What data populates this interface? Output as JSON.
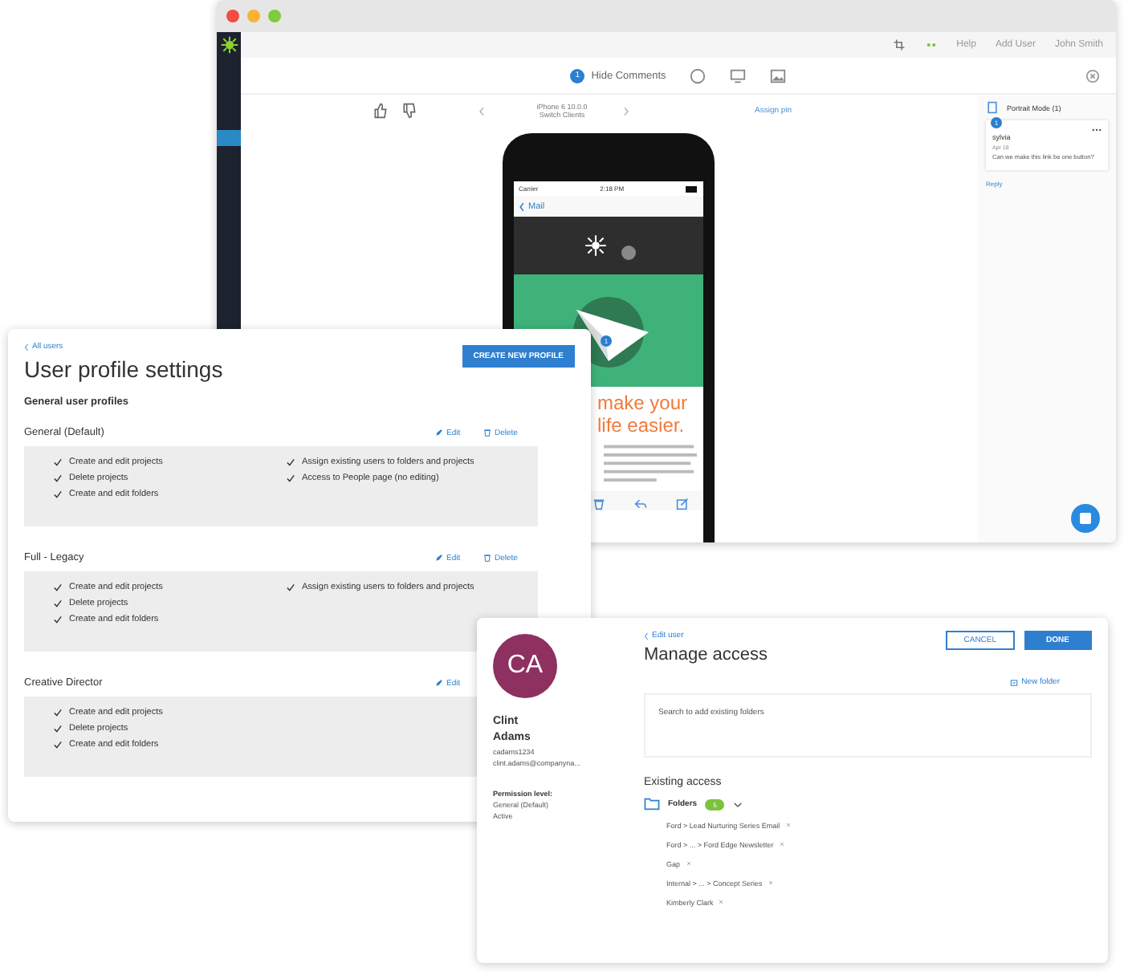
{
  "review_window": {
    "toolbar": {
      "help": "Help",
      "add_user": "Add User",
      "user_name": "John Smith"
    },
    "review_bar": {
      "comment_count": "1",
      "hide_comments": "Hide Comments"
    },
    "device": {
      "name": "iPhone 6 10.0.0",
      "subtitle": "Switch Clients",
      "assign": "Assign pin"
    },
    "phone": {
      "carrier": "Carrier",
      "time": "2:18 PM",
      "back": "Mail",
      "pin": "1",
      "headline": [
        "make your",
        "life easier."
      ]
    },
    "comments": {
      "title": "Portrait Mode (1)",
      "items": [
        {
          "number": "1",
          "author": "sylvia",
          "date": "Apr 18",
          "text": "Can we make this link be one button?"
        }
      ],
      "reply": "Reply"
    }
  },
  "profiles_window": {
    "back": "All users",
    "title": "User profile settings",
    "create_button": "CREATE NEW PROFILE",
    "section": "General user profiles",
    "profiles": [
      {
        "name": "General (Default)",
        "edit": "Edit",
        "delete": "Delete",
        "permissions": [
          [
            "Create and edit projects",
            "Delete projects",
            "Create and edit folders"
          ],
          [
            "Assign existing users to folders and projects",
            "Access to People page (no editing)"
          ]
        ]
      },
      {
        "name": "Full - Legacy",
        "edit": "Edit",
        "delete": "Delete",
        "permissions": [
          [
            "Create and edit projects",
            "Delete projects",
            "Create and edit folders"
          ],
          [
            "Assign existing users to folders and projects"
          ]
        ]
      },
      {
        "name": "Creative Director",
        "edit": "Edit",
        "permissions": [
          [
            "Create and edit projects",
            "Delete projects",
            "Create and edit folders"
          ]
        ]
      }
    ]
  },
  "access_window": {
    "user": {
      "initials": "CA",
      "first_name": "Clint",
      "last_name": "Adams",
      "username": "cadams1234",
      "email": "clint.adams@companyna...",
      "permission_label": "Permission level:",
      "permission": "General (Default)",
      "status": "Active"
    },
    "back": "Edit user",
    "title": "Manage access",
    "cancel": "CANCEL",
    "done": "DONE",
    "new_folder": "New folder",
    "search": {
      "placeholder": "Search to add existing folders"
    },
    "existing_title": "Existing access",
    "folders": {
      "label": "Folders",
      "count": "5",
      "expanded": true,
      "items": [
        "Ford > Lead Nurturing Series Email",
        "Ford > ... > Ford Edge Newsletter",
        "Gap",
        "Internal > ... > Concept Series",
        "Kimberly Clark"
      ]
    }
  }
}
